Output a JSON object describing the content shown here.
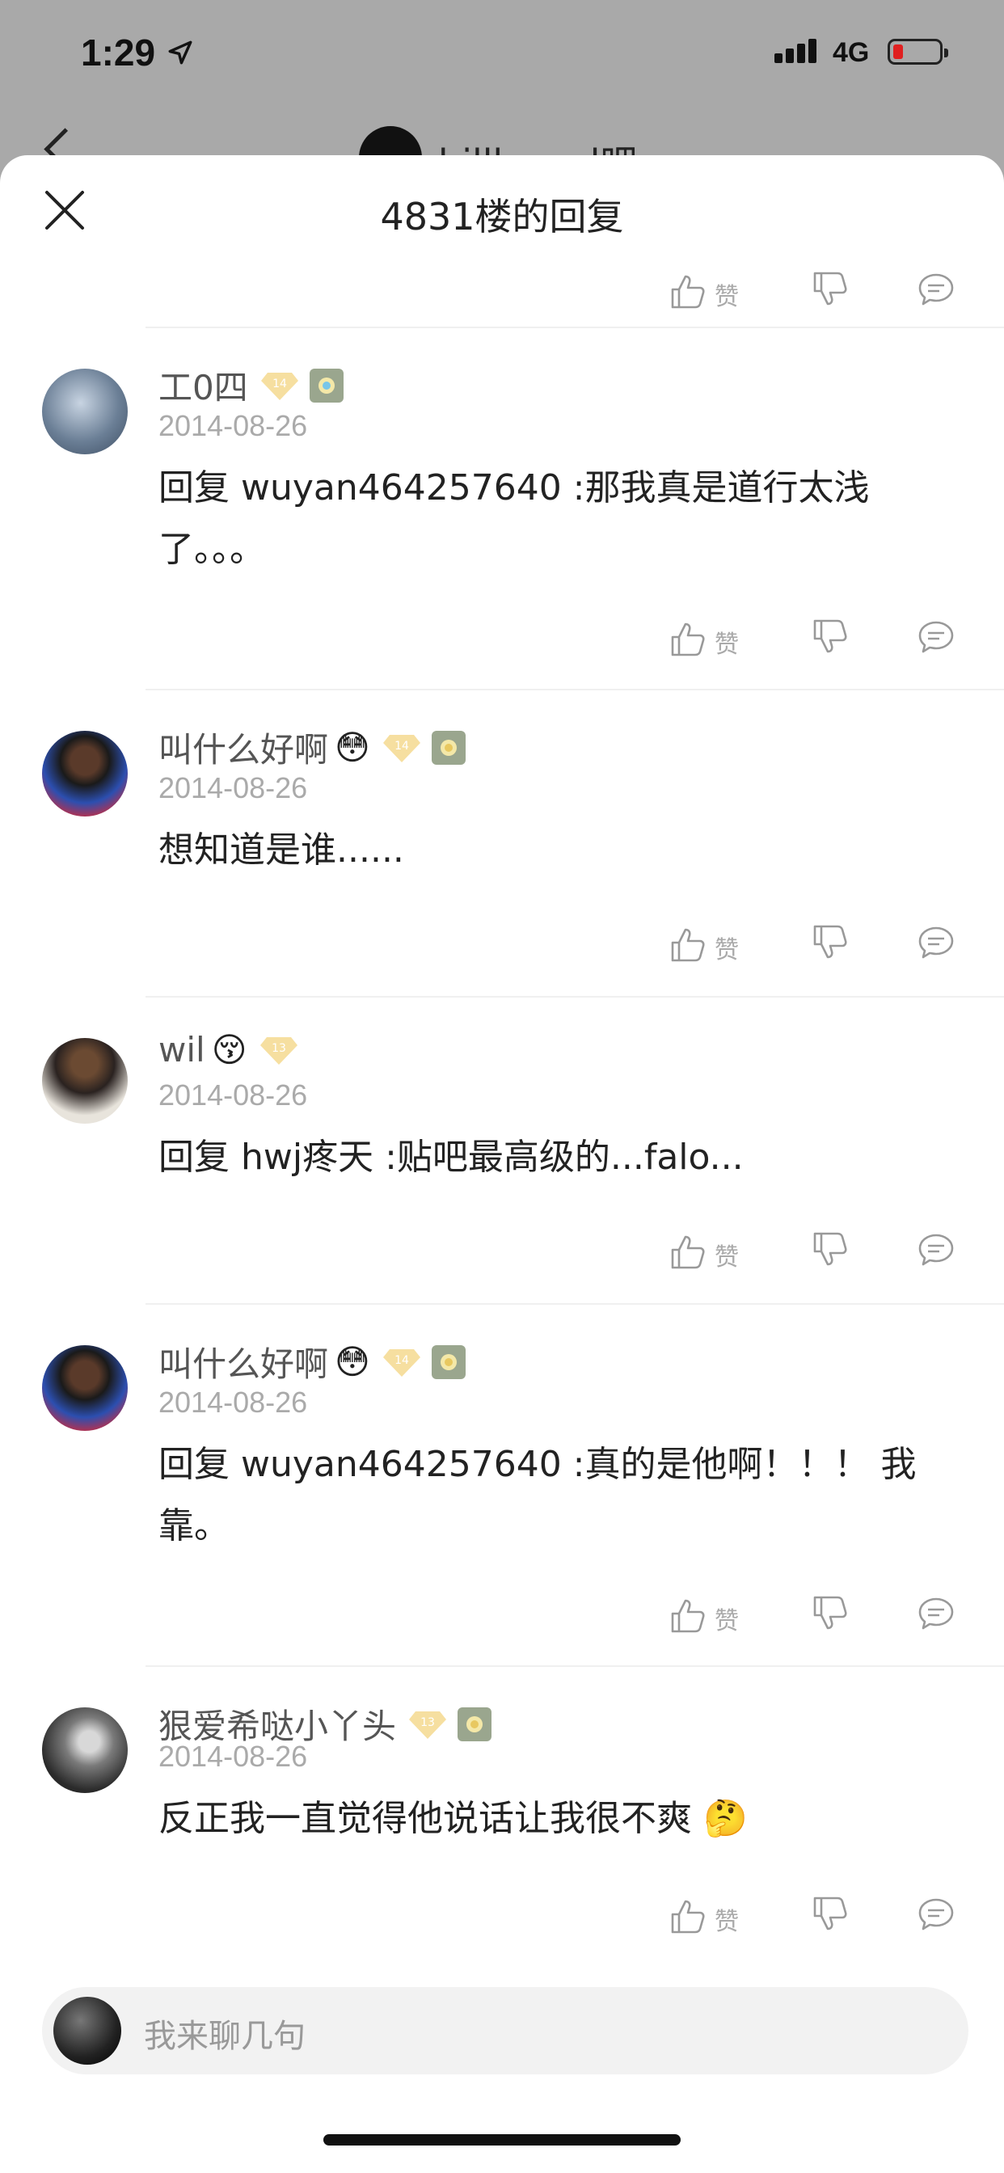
{
  "status_bar": {
    "time": "1:29",
    "network": "4G"
  },
  "behind": {
    "title": "billboard吧"
  },
  "sheet": {
    "title": "4831楼的回复"
  },
  "actions": {
    "like_label": "赞"
  },
  "replies": [
    {
      "username": "工0四",
      "emoji": "",
      "level": "14",
      "date": "2014-08-26",
      "lines": [
        "回复 wuyan464257640 :那我真是道行太浅",
        "了。。。"
      ]
    },
    {
      "username": "叫什么好啊",
      "emoji": "😳",
      "level": "14",
      "date": "2014-08-26",
      "lines": [
        "想知道是谁......"
      ]
    },
    {
      "username": "wil",
      "emoji": "😚",
      "level": "13",
      "date": "2014-08-26",
      "lines": [
        "回复 hwj疼天 :贴吧最高级的...falo..."
      ]
    },
    {
      "username": "叫什么好啊",
      "emoji": "😳",
      "level": "14",
      "date": "2014-08-26",
      "lines": [
        "回复 wuyan464257640 :真的是他啊！！！ 我",
        "靠。"
      ]
    },
    {
      "username": "狠爱希哒小丫头",
      "emoji": "",
      "level": "13",
      "date": "2014-08-26",
      "lines": [
        "反正我一直觉得他说话让我很不爽 🤔"
      ]
    }
  ],
  "input": {
    "placeholder": "我来聊几句"
  }
}
